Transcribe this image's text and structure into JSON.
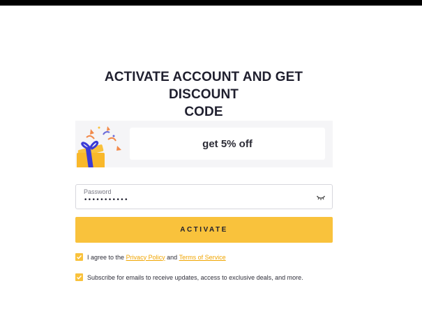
{
  "header": {
    "title_line1": "ACTIVATE ACCOUNT AND GET DISCOUNT",
    "title_line2": "CODE"
  },
  "promo": {
    "icon": "gift-icon",
    "text": "get 5% off"
  },
  "password": {
    "label": "Password",
    "masked_value": "•••••••••••",
    "toggle_icon": "eye-closed-icon"
  },
  "activate": {
    "label": "ACTIVATE"
  },
  "consent": {
    "agree_prefix": "I agree to the",
    "privacy_link": "Privacy Policy",
    "agree_and": "and",
    "terms_link": "Terms of Service",
    "agree_checked": true,
    "subscribe_text": "Subscribe for emails to receive updates, access to exclusive deals, and more.",
    "subscribe_checked": true
  },
  "colors": {
    "accent": "#f9c23c",
    "link": "#f0a500",
    "gift_purple": "#3b3bd6",
    "promo_bg": "#f5f5f7"
  }
}
